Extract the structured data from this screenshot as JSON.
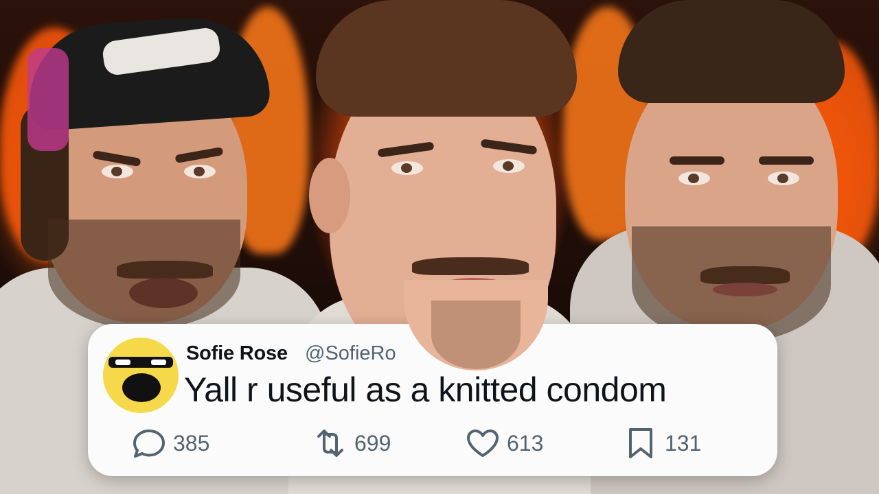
{
  "tweet": {
    "author_name": "Sofie Rose",
    "author_handle": "@SofieRo",
    "text": "Yall r useful as a knitted condom",
    "avatar_icon": "cartoon-face-avatar-icon",
    "metrics": {
      "replies": "385",
      "retweets": "699",
      "likes": "613",
      "bookmarks": "131"
    },
    "icons": {
      "replies": "speech-bubble-icon",
      "retweets": "retweet-icon",
      "likes": "heart-icon",
      "bookmarks": "bookmark-icon"
    }
  },
  "colors": {
    "card_bg": "#fbfbfc",
    "text_primary": "#0f1419",
    "text_secondary": "#536471",
    "fire": "#ff6a10"
  }
}
